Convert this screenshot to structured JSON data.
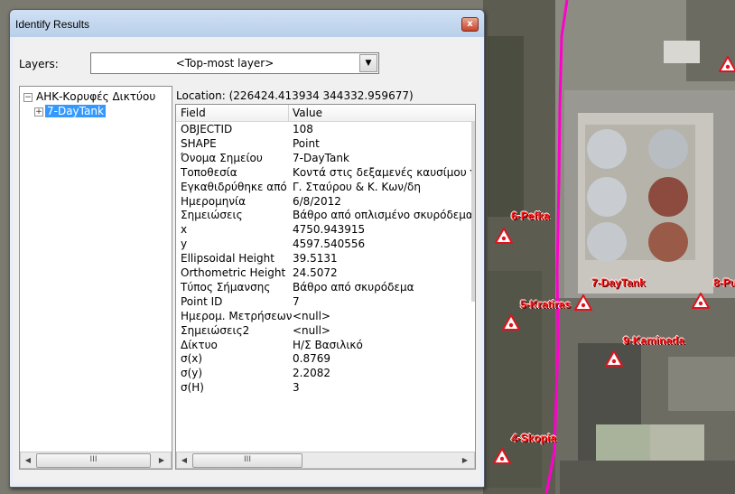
{
  "window": {
    "title": "Identify Results",
    "close_glyph": "x"
  },
  "layers": {
    "label": "Layers:",
    "selected": "<Top-most layer>"
  },
  "tree": {
    "root_label": "ΑΗΚ-Κορυφές Δικτύου",
    "child_label": "7-DayTank",
    "expanded_glyph": "−",
    "collapsed_glyph": "+"
  },
  "location": "Location: (226424.413934 344332.959677)",
  "table": {
    "columns": [
      "Field",
      "Value"
    ],
    "rows": [
      {
        "field": "OBJECTID",
        "value": "108"
      },
      {
        "field": "SHAPE",
        "value": "Point"
      },
      {
        "field": "Όνομα Σημείου",
        "value": "7-DayTank"
      },
      {
        "field": "Τοποθεσία",
        "value": "Κοντά στις δεξαμενές καυσίμου για"
      },
      {
        "field": "Εγκαθιδρύθηκε από",
        "value": "Γ. Σταύρου & Κ. Κων/δη"
      },
      {
        "field": "Ημερομηνία",
        "value": "6/8/2012"
      },
      {
        "field": "Σημειώσεις",
        "value": "Βάθρο από οπλισμένο σκυρόδεμα, ε"
      },
      {
        "field": "x",
        "value": "4750.943915"
      },
      {
        "field": "y",
        "value": "4597.540556"
      },
      {
        "field": "Ellipsoidal Height",
        "value": "39.5131"
      },
      {
        "field": "Orthometric Height",
        "value": "24.5072"
      },
      {
        "field": "Τύπος Σήμανσης",
        "value": "Βάθρο από σκυρόδεμα"
      },
      {
        "field": "Point ID",
        "value": "7"
      },
      {
        "field": "Ημερομ. Μετρήσεων",
        "value": "<null>"
      },
      {
        "field": "Σημειώσεις2",
        "value": "<null>"
      },
      {
        "field": "Δίκτυο",
        "value": "Η/Σ Βασιλικό"
      },
      {
        "field": "σ(x)",
        "value": "0.8769"
      },
      {
        "field": "σ(y)",
        "value": "2.2082"
      },
      {
        "field": "σ(H)",
        "value": "3"
      }
    ]
  },
  "scrollbar": {
    "left_glyph": "◀",
    "right_glyph": "▶",
    "thumb_glyph": "III"
  },
  "map": {
    "labels": [
      "6-Pefka",
      "7-DayTank",
      "8-Pu",
      "5-Kratiras",
      "9-Kaminada",
      "4-Skopia"
    ],
    "marker_icon": "survey-point-triangle-icon",
    "route_color": "#ff00cc",
    "marker_color": "#e0141e"
  }
}
